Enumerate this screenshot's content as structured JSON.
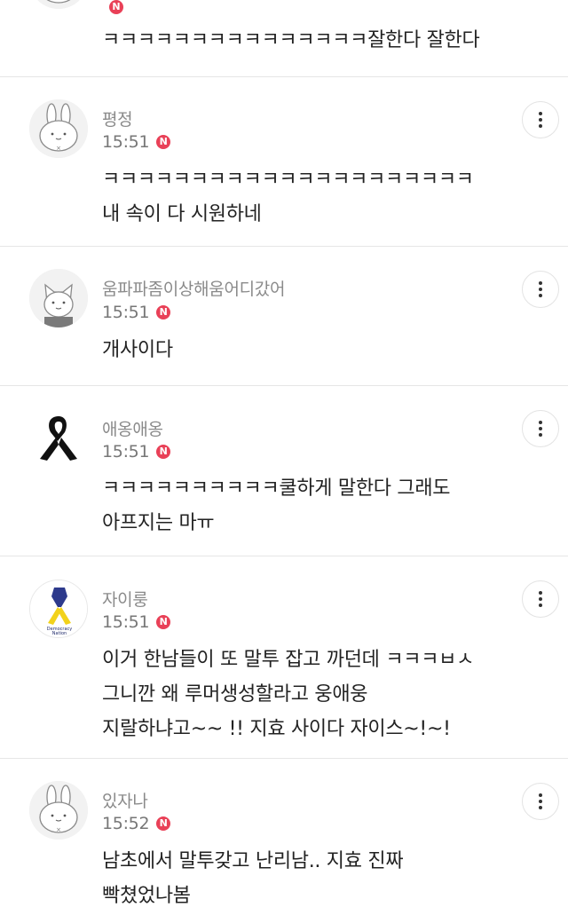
{
  "comments": [
    {
      "author": "",
      "time": "",
      "badge": "N",
      "lines": [
        "ㅋㅋㅋㅋㅋㅋㅋㅋㅋㅋㅋㅋㅋㅋㅋ잘한다 잘한다"
      ]
    },
    {
      "author": "평정",
      "time": "15:51",
      "badge": "N",
      "lines": [
        "ㅋㅋㅋㅋㅋㅋㅋㅋㅋㅋㅋㅋㅋㅋㅋㅋㅋㅋㅋㅋㅋ",
        "내 속이 다 시원하네"
      ]
    },
    {
      "author": "움파파좀이상해움어디갔어",
      "time": "15:51",
      "badge": "N",
      "lines": [
        "개사이다"
      ]
    },
    {
      "author": "애옹애옹",
      "time": "15:51",
      "badge": "N",
      "lines": [
        "ㅋㅋㅋㅋㅋㅋㅋㅋㅋㅋ쿨하게 말한다 그래도",
        "아프지는 마ㅠ"
      ]
    },
    {
      "author": "자이룽",
      "time": "15:51",
      "badge": "N",
      "lines": [
        "이거 한남들이 또 말투 잡고 까던데 ㅋㅋㅋㅂㅅ",
        "그니깐 왜 루머생성할라고 웅애웅",
        "지랄하냐고~~ !! 지효 사이다 자이스~!~!"
      ]
    },
    {
      "author": "있자나",
      "time": "15:52",
      "badge": "N",
      "lines": [
        "남초에서 말투갖고 난리남.. 지효 진짜",
        "빡쳤었나봄"
      ]
    }
  ],
  "avatar_images": {
    "rabbit_text": "×",
    "ribbon_text_1": "Democracy",
    "ribbon_text_2": "Nation"
  },
  "icons": {
    "more": "vertical-dots-icon",
    "new": "new-badge"
  },
  "colors": {
    "badge": "#e94057",
    "author": "#8a8a8a",
    "time": "#777777",
    "body": "#222222",
    "divider": "#e6e6e6"
  }
}
